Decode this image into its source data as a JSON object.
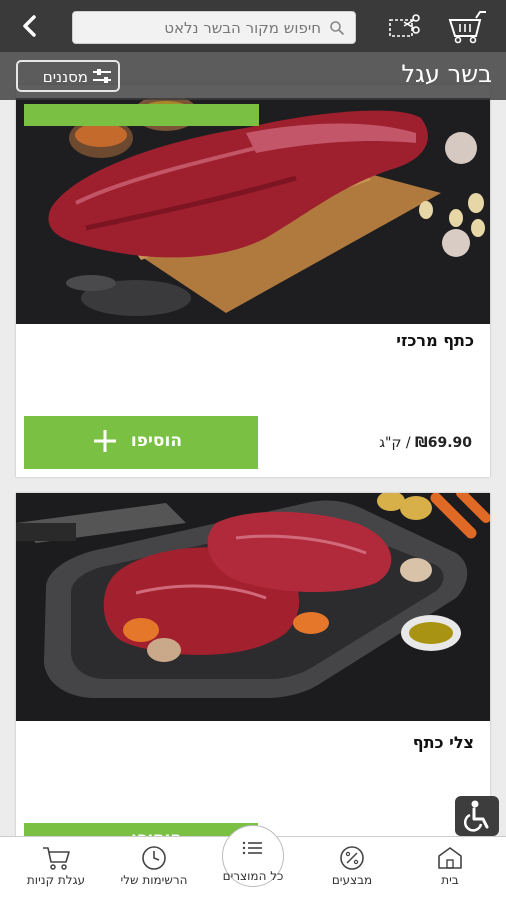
{
  "header": {
    "search_placeholder": "חיפוש מקור הבשר נלאט",
    "icons": [
      "back-chevron-icon",
      "search-icon",
      "scissors-icon",
      "basket-icon"
    ]
  },
  "category": {
    "title": "בשר עגל",
    "filter_label": "מסננים"
  },
  "products": [
    {
      "name": "כתף מרכזי",
      "price": "₪69.90",
      "unit": " / ק\"ג",
      "add_label": "הוסיפו"
    },
    {
      "name": "צלי כתף",
      "add_label": "הוסיפו"
    }
  ],
  "bottom_nav": {
    "items": [
      {
        "label": "עגלת קניות",
        "icon": "cart-icon"
      },
      {
        "label": "הרשימות שלי",
        "icon": "clock-icon"
      },
      {
        "label": "כל המוצרים",
        "icon": "list-icon"
      },
      {
        "label": "מבצעים",
        "icon": "percent-icon"
      },
      {
        "label": "בית",
        "icon": "home-icon"
      }
    ]
  },
  "colors": {
    "accent_green": "#7ac143",
    "topbar": "#3a3a3a",
    "photo_bg": "#1c1c1e"
  }
}
